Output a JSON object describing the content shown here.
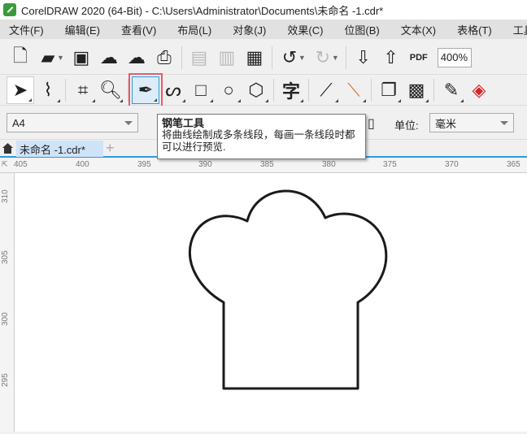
{
  "window": {
    "title": "CorelDRAW 2020 (64-Bit) - C:\\Users\\Administrator\\Documents\\未命名 -1.cdr*"
  },
  "menu": [
    "文件(F)",
    "编辑(E)",
    "查看(V)",
    "布局(L)",
    "对象(J)",
    "效果(C)",
    "位图(B)",
    "文本(X)",
    "表格(T)",
    "工具(O)"
  ],
  "toolbar": {
    "zoom": "400%",
    "pdf_label": "PDF"
  },
  "toolbox": {
    "text_tool_glyph": "字",
    "active_tool": "pen-tool"
  },
  "property_bar": {
    "page_size": "A4",
    "unit_label": "单位:",
    "unit_value": "毫米"
  },
  "tooltip": {
    "title": "钢笔工具",
    "body": "将曲线绘制成多条线段，每画一条线段时都可以进行预览."
  },
  "document_tabs": [
    {
      "label": "未命名 -1.cdr*"
    }
  ],
  "rulers": {
    "horizontal": [
      "405",
      "400",
      "395",
      "390",
      "385",
      "380",
      "375",
      "370",
      "365"
    ],
    "vertical": [
      "310",
      "305",
      "300",
      "295"
    ]
  },
  "colors": {
    "accent": "#2a9be0",
    "highlight": "#e85a6a"
  }
}
